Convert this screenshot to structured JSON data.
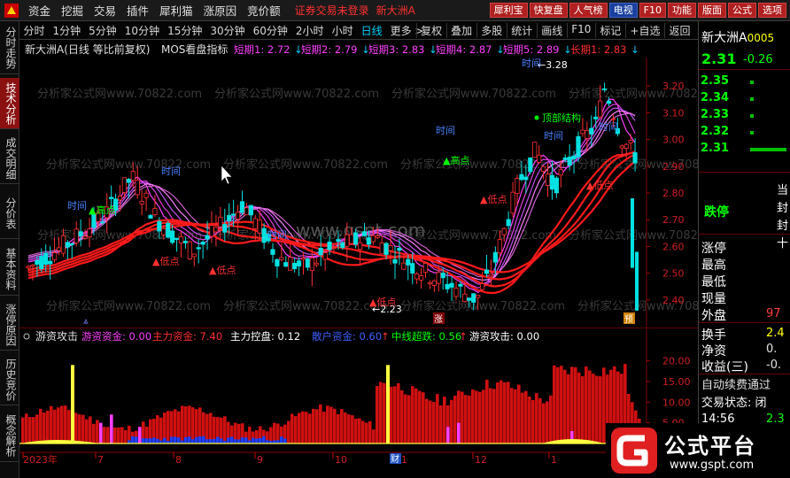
{
  "menu": {
    "items": [
      "资金",
      "挖掘",
      "交易",
      "插件",
      "犀利猫",
      "涨原因",
      "竞价额"
    ],
    "notice": "证券交易未登录",
    "notice2": "新大洲A",
    "tools": [
      {
        "label": "犀利宝",
        "style": "red"
      },
      {
        "label": "快复盘",
        "style": "red"
      },
      {
        "label": "人气榜",
        "style": "red"
      },
      {
        "label": "电视",
        "style": "blue"
      },
      {
        "label": "F10",
        "style": "red"
      },
      {
        "label": "功能",
        "style": "red"
      },
      {
        "label": "版面",
        "style": "red"
      },
      {
        "label": "公式",
        "style": "red"
      },
      {
        "label": "选项",
        "style": "red"
      }
    ]
  },
  "left_tabs": [
    {
      "label": "分时走势",
      "active": false
    },
    {
      "label": "技术分析",
      "active": true
    },
    {
      "label": "成交明细",
      "active": false
    },
    {
      "label": "分价表",
      "active": false
    },
    {
      "label": "基本资料",
      "active": false
    },
    {
      "label": "涨停原因",
      "active": false
    },
    {
      "label": "历史竞价",
      "active": false
    },
    {
      "label": "概念解析",
      "active": false
    }
  ],
  "periods": [
    "分时",
    "1分钟",
    "5分钟",
    "10分钟",
    "15分钟",
    "30分钟",
    "60分钟",
    "2小时",
    "小时",
    "日线",
    "更多 >"
  ],
  "selected_period": "日线",
  "period_right": [
    "复权",
    "叠加",
    "多股",
    "统计",
    "画线",
    "F10",
    "标记",
    "+自选",
    "返回"
  ],
  "main_chart": {
    "title": "新大洲A(日线 等比前复权)",
    "indicator": "MOS看盘指标",
    "params": [
      {
        "label": "短期1: 2.72",
        "color": "#ff40ff"
      },
      {
        "label": "短期2: 2.79",
        "color": "#ff40ff"
      },
      {
        "label": "短期3: 2.83",
        "color": "#ff40ff"
      },
      {
        "label": "短期4: 2.87",
        "color": "#ff40ff"
      },
      {
        "label": "短期5: 2.89",
        "color": "#ff40ff"
      },
      {
        "label": "长期1: 2.83",
        "color": "#ff3030"
      }
    ],
    "y_ticks": [
      "3.20",
      "3.10",
      "3.00",
      "2.90",
      "2.80",
      "2.70",
      "2.60",
      "2.50",
      "2.40"
    ],
    "ylim": [
      2.32,
      3.3
    ],
    "annotations": {
      "high_value": "3.28",
      "low_value": "2.23",
      "top_structure": "顶部结构",
      "high_point": "高点",
      "low_point": "低点",
      "time_label": "时间"
    },
    "watermark": "分析家公式网www.70822.com",
    "watermark_center": "www.gspt.com",
    "markers": {
      "zhang": "涨",
      "yu": "预",
      "cai": "财"
    }
  },
  "sub_chart": {
    "title": "游资攻击",
    "params": [
      {
        "label": "游资资金: 0.00",
        "color": "#ff40ff"
      },
      {
        "label": "主力资金: 7.40",
        "color": "#ff3030"
      },
      {
        "label": "主力控盘: 0.12",
        "color": "#ffffff"
      },
      {
        "label": "散户资金: 0.60",
        "color": "#4060ff"
      },
      {
        "label": "中线超跌: 0.56",
        "color": "#00ff00"
      },
      {
        "label": "游资攻击: 0.00",
        "color": "#ffffff"
      }
    ],
    "y_ticks": [
      "20.00",
      "15.00",
      "10.00",
      "5.00"
    ],
    "ylim": [
      0,
      24
    ]
  },
  "time_axis": [
    "2023年",
    "7",
    "8",
    "9",
    "10",
    "11",
    "12",
    "1"
  ],
  "quote": {
    "name": "新大洲A",
    "code": "0005",
    "price": "2.31",
    "change": "-0.26",
    "book": [
      {
        "price": "2.35",
        "bar": 0.03
      },
      {
        "price": "2.34",
        "bar": 0.03
      },
      {
        "price": "2.33",
        "bar": 0.03
      },
      {
        "price": "2.32",
        "bar": 0.03
      },
      {
        "price": "2.31",
        "bar": 0.9
      }
    ],
    "limit_label": "跌停",
    "right_chars": [
      "当",
      "封",
      "封",
      "十"
    ],
    "rows": [
      {
        "label": "涨停",
        "value": ""
      },
      {
        "label": "最高",
        "value": ""
      },
      {
        "label": "最低",
        "value": ""
      },
      {
        "label": "现量",
        "value": ""
      },
      {
        "label": "外盘",
        "value": "97"
      }
    ],
    "rows2": [
      {
        "label": "换手",
        "value": "2.4"
      },
      {
        "label": "净资",
        "value": "0."
      },
      {
        "label": "收益(三)",
        "value": "-0."
      }
    ],
    "auto_renew": "自动续费通过",
    "trade_state": "交易状态: 闭",
    "time": "14:56",
    "time_price": "2.3"
  },
  "brand": {
    "title": "公式平台",
    "url": "www.gspt.com"
  }
}
